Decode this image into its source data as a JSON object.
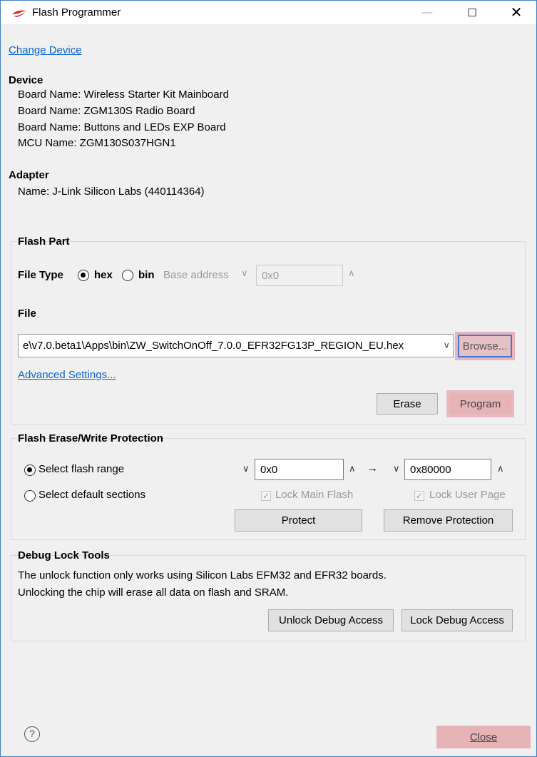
{
  "window": {
    "title": "Flash Programmer",
    "buttons": {
      "minimize": "—",
      "maximize": "☐",
      "close": "✕"
    }
  },
  "change_device_link": "Change Device",
  "device": {
    "heading": "Device",
    "lines": [
      "Board Name: Wireless Starter Kit Mainboard",
      "Board Name: ZGM130S Radio Board",
      "Board Name: Buttons and LEDs EXP Board",
      "MCU Name: ZGM130S037HGN1"
    ]
  },
  "adapter": {
    "heading": "Adapter",
    "name": "Name: J-Link Silicon Labs (440114364)"
  },
  "flash_part": {
    "heading": "Flash Part",
    "file_type_label": "File Type",
    "hex_label": "hex",
    "bin_label": "bin",
    "selected_type": "hex",
    "base_address_label": "Base address",
    "base_address_value": "0x0",
    "file_label": "File",
    "file_value": "e\\v7.0.beta1\\Apps\\bin\\ZW_SwitchOnOff_7.0.0_EFR32FG13P_REGION_EU.hex",
    "browse_label": "Browse...",
    "advanced_link": "Advanced Settings...",
    "erase_label": "Erase",
    "program_label": "Program"
  },
  "protection": {
    "heading": "Flash Erase/Write Protection",
    "select_range_label": "Select flash range",
    "select_default_label": "Select default sections",
    "range_from": "0x0",
    "range_to": "0x80000",
    "arrow": "→",
    "lock_main_flash_label": "Lock Main Flash",
    "lock_user_page_label": "Lock User Page",
    "protect_label": "Protect",
    "remove_protection_label": "Remove Protection"
  },
  "debug_lock": {
    "heading": "Debug Lock Tools",
    "line1": "The unlock function only works using Silicon Labs EFM32 and EFR32 boards.",
    "line2": "Unlocking the chip will erase all data on flash and SRAM.",
    "unlock_label": "Unlock Debug Access",
    "lock_label": "Lock Debug Access"
  },
  "footer": {
    "help_glyph": "?",
    "close_label": "Close"
  },
  "colors": {
    "link": "#0b63c9",
    "highlight": "#e6b3b6",
    "window_border": "#3f7fc4"
  }
}
